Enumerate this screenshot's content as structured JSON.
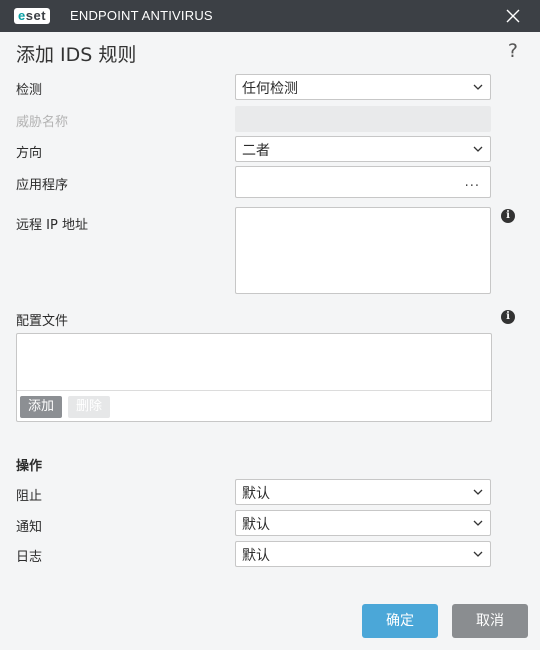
{
  "titlebar": {
    "logo_text": "eset",
    "product": "ENDPOINT ANTIVIRUS"
  },
  "dialog": {
    "title": "添加 IDS 规则",
    "help": "?"
  },
  "fields": {
    "detection": {
      "label": "检测",
      "value": "任何检测"
    },
    "threat_name": {
      "label": "威胁名称"
    },
    "direction": {
      "label": "方向",
      "value": "二者"
    },
    "application": {
      "label": "应用程序",
      "browse": "..."
    },
    "remote_ip": {
      "label": "远程 IP 地址"
    },
    "profiles": {
      "label": "配置文件",
      "add": "添加",
      "delete": "删除"
    }
  },
  "actions": {
    "title": "操作",
    "block": {
      "label": "阻止",
      "value": "默认"
    },
    "notify": {
      "label": "通知",
      "value": "默认"
    },
    "log": {
      "label": "日志",
      "value": "默认"
    }
  },
  "buttons": {
    "ok": "确定",
    "cancel": "取消"
  },
  "colors": {
    "titlebar": "#3c4045",
    "accent": "#4ba7d8",
    "eset_teal": "#0ba0a4"
  }
}
